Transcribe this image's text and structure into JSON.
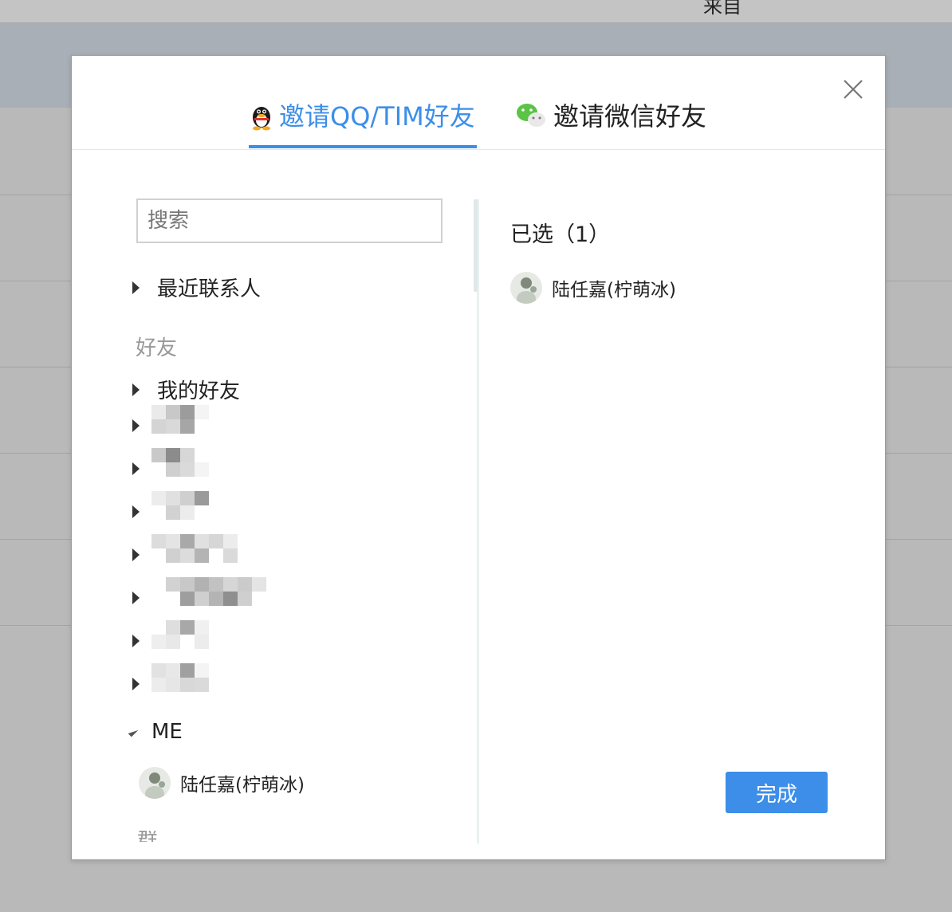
{
  "background": {
    "topbar_text": "来自"
  },
  "tabs": [
    {
      "label": "邀请QQ/TIM好友",
      "icon": "qq-penguin-icon",
      "active": true
    },
    {
      "label": "邀请微信好友",
      "icon": "wechat-icon",
      "active": false
    }
  ],
  "search": {
    "placeholder": "搜索",
    "value": ""
  },
  "tree": {
    "recent_label": "最近联系人",
    "friends_section": "好友",
    "my_friends_label": "我的好友",
    "me_group_label": "ME",
    "me_contact_name": "陆任嘉(柠萌冰)",
    "next_section_cut": "群"
  },
  "selected": {
    "title": "已选（1）",
    "items": [
      {
        "name": "陆任嘉(柠萌冰)"
      }
    ]
  },
  "done_label": "完成",
  "colors": {
    "accent": "#3c8ee9",
    "overlay": "#b9b9b9"
  }
}
